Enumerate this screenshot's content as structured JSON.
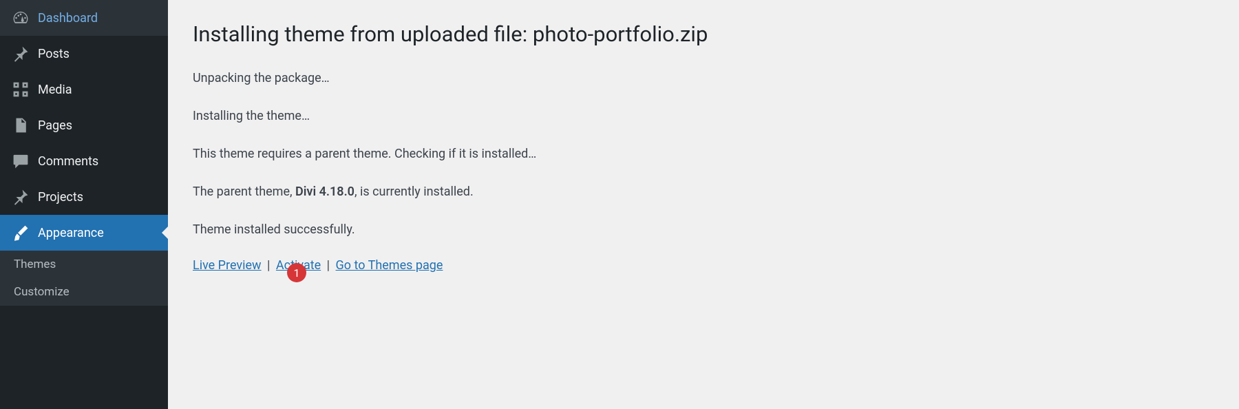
{
  "sidebar": {
    "items": [
      {
        "label": "Dashboard",
        "icon": "dashboard-icon"
      },
      {
        "label": "Posts",
        "icon": "pin-icon"
      },
      {
        "label": "Media",
        "icon": "media-icon"
      },
      {
        "label": "Pages",
        "icon": "pages-icon"
      },
      {
        "label": "Comments",
        "icon": "comment-icon"
      },
      {
        "label": "Projects",
        "icon": "pin-icon"
      },
      {
        "label": "Appearance",
        "icon": "brush-icon"
      }
    ],
    "submenu": [
      {
        "label": "Themes"
      },
      {
        "label": "Customize"
      }
    ]
  },
  "main": {
    "title": "Installing theme from uploaded file: photo-portfolio.zip",
    "status": {
      "line1": "Unpacking the package…",
      "line2": "Installing the theme…",
      "line3": "This theme requires a parent theme. Checking if it is installed…",
      "line4_pre": "The parent theme, ",
      "line4_strong": "Divi 4.18.0",
      "line4_post": ", is currently installed.",
      "line5": "Theme installed successfully."
    },
    "actions": {
      "live_preview": "Live Preview",
      "activate": "Activate",
      "themes_page": "Go to Themes page"
    },
    "badge": "1"
  }
}
